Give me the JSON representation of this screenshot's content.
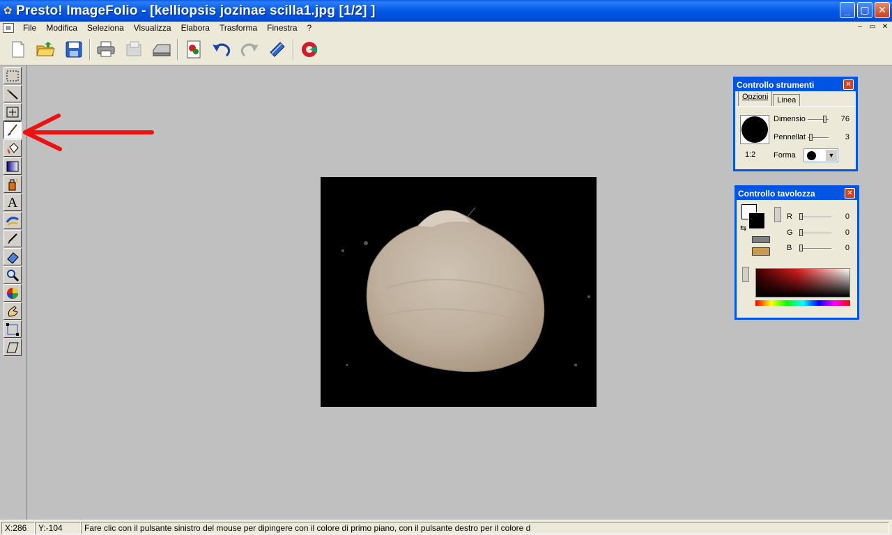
{
  "window": {
    "icon": "presto-app-icon",
    "title": "Presto! ImageFolio - [kelliopsis jozinae scilla1.jpg [1/2] ]",
    "controls": [
      "minimize-icon",
      "maximize-icon",
      "close-icon"
    ]
  },
  "menu": {
    "items": [
      "File",
      "Modifica",
      "Seleziona",
      "Visualizza",
      "Elabora",
      "Trasforma",
      "Finestra",
      "?"
    ],
    "mdi_controls": [
      "–",
      "▭",
      "✕"
    ]
  },
  "toolbar": {
    "buttons": [
      "new-document-icon",
      "open-folder-icon",
      "save-disk-icon",
      "print-icon",
      "copy-print-icon",
      "scanner-icon",
      "acquire-icon",
      "undo-icon",
      "redo-icon",
      "help-book-icon",
      "exit-icon"
    ]
  },
  "tools": {
    "items": [
      "rectangle-select-icon",
      "magic-wand-icon",
      "move-icon",
      "paintbrush-icon",
      "fill-bucket-icon",
      "gradient-icon",
      "spray-can-icon",
      "text-tool-icon",
      "clone-stamp-icon",
      "eyedropper-icon",
      "eraser-icon",
      "magnifier-icon",
      "color-wheel-icon",
      "smudge-hand-icon",
      "transform-icon",
      "perspective-icon"
    ],
    "active_index": 3,
    "text_glyph": "A"
  },
  "panel_tools": {
    "title": "Controllo strumenti",
    "tabs": [
      "Opzioni",
      "Linea"
    ],
    "ratio": "1:2",
    "dimension_label": "Dimensio",
    "dimension_value": "76",
    "brush_label": "Pennellat",
    "brush_value": "3",
    "shape_label": "Forma"
  },
  "panel_palette": {
    "title": "Controllo tavolozza",
    "r_label": "R",
    "r_value": "0",
    "g_label": "G",
    "g_value": "0",
    "b_label": "B",
    "b_value": "0"
  },
  "status": {
    "x": "X:286",
    "y": "Y:-104",
    "message": "Fare clic con il pulsante sinistro del mouse per dipingere con il colore di primo piano, con il pulsante destro per il colore d"
  },
  "colors": {
    "titlebar": "#0054e3",
    "workspace": "#c0c0c0",
    "annotation_arrow": "#ee1111"
  }
}
